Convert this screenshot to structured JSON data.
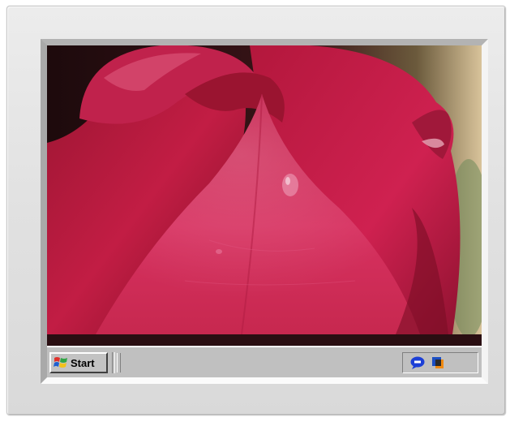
{
  "wallpaper": {
    "subject": "red-rose-closeup",
    "accent": "#c8204a"
  },
  "taskbar": {
    "start_label": "Start",
    "start_icon": "windows-flag-icon",
    "background": "#c0c0c0",
    "tray_icons": [
      "speech-bubble-icon",
      "network-icon"
    ]
  }
}
